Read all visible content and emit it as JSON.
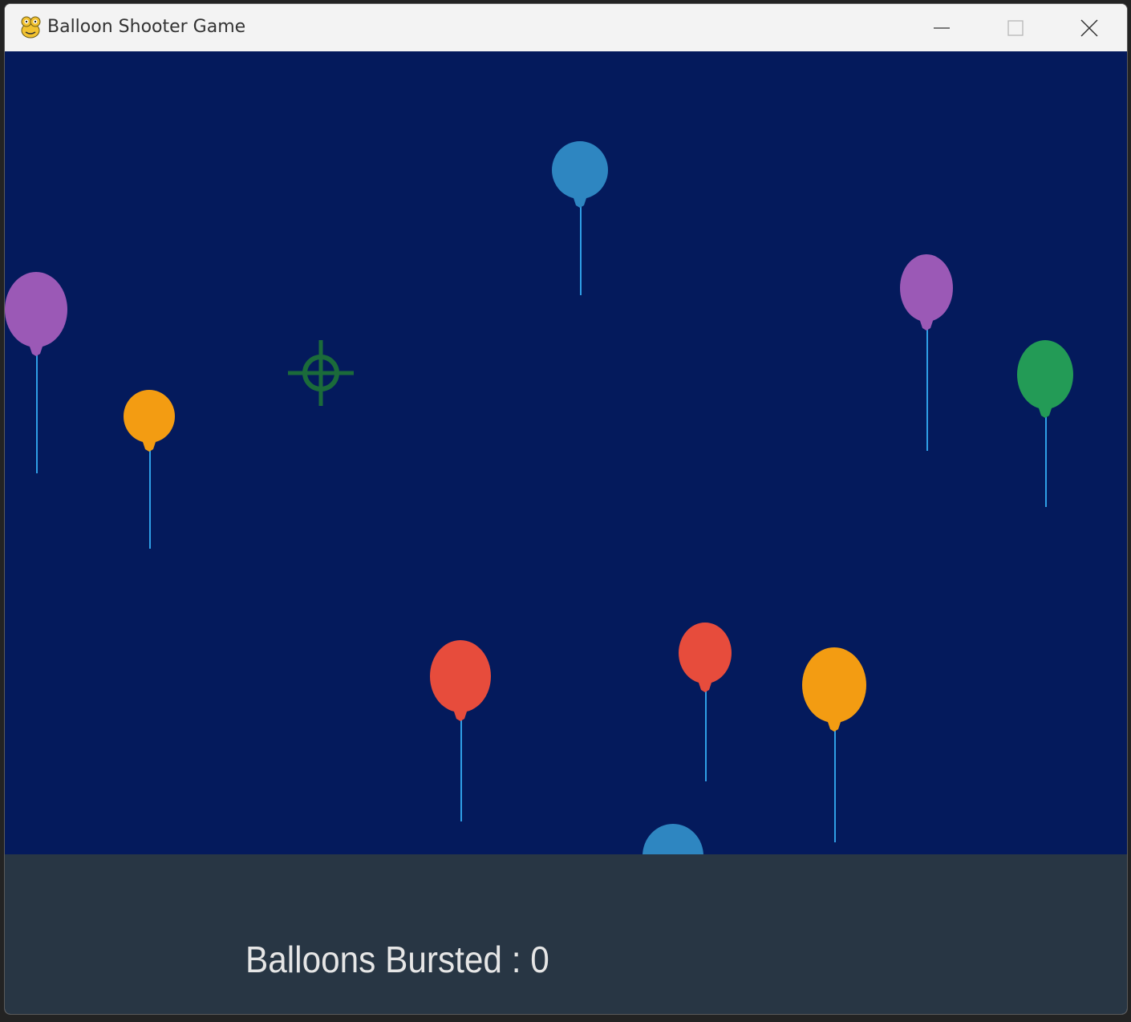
{
  "window": {
    "title": "Balloon Shooter Game",
    "controls": [
      "minimize-icon",
      "maximize-icon",
      "close-icon"
    ]
  },
  "game": {
    "background_color": "#041a5c",
    "crosshair_color": "#1b6b3a",
    "string_color": "#2f9fe6",
    "balloons": [
      {
        "color_name": "purple",
        "color": "#9b59b6"
      },
      {
        "color_name": "orange",
        "color": "#f39c12"
      },
      {
        "color_name": "blue",
        "color": "#2e86c1"
      },
      {
        "color_name": "purple",
        "color": "#9b59b6"
      },
      {
        "color_name": "green",
        "color": "#239b56"
      },
      {
        "color_name": "red",
        "color": "#e74c3c"
      },
      {
        "color_name": "red",
        "color": "#e74c3c"
      },
      {
        "color_name": "orange",
        "color": "#f39c12"
      },
      {
        "color_name": "blue",
        "color": "#2e86c1"
      }
    ]
  },
  "score": {
    "label": "Balloons Bursted : 0",
    "value": 0
  }
}
